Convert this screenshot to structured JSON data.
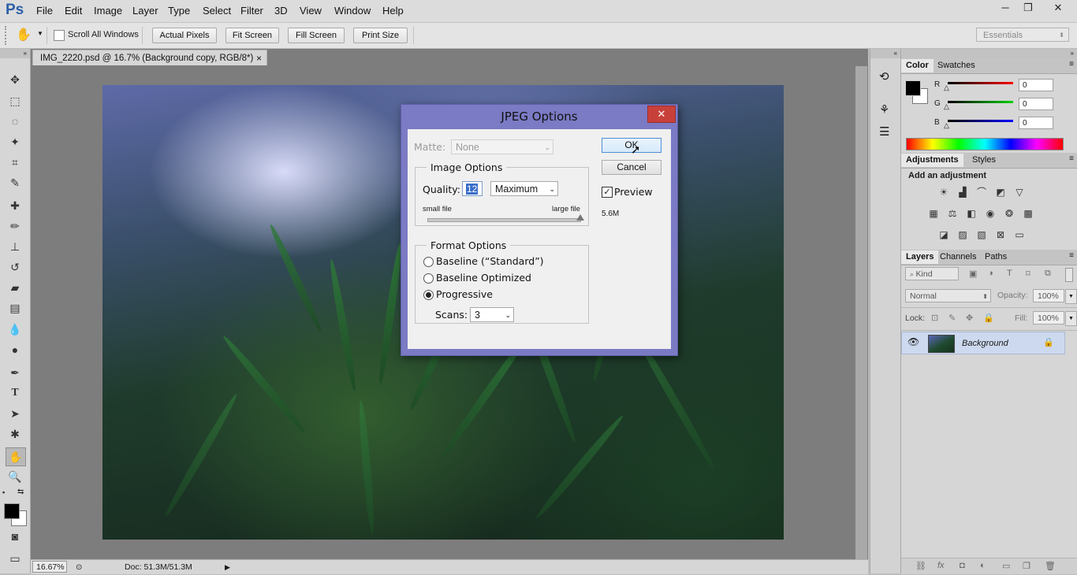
{
  "app": {
    "logo": "Ps"
  },
  "menu": [
    "File",
    "Edit",
    "Image",
    "Layer",
    "Type",
    "Select",
    "Filter",
    "3D",
    "View",
    "Window",
    "Help"
  ],
  "window_controls": {
    "minimize": "─",
    "restore": "❐",
    "close": "✕"
  },
  "options_bar": {
    "scroll_all_label": "Scroll All Windows",
    "buttons": [
      "Actual Pixels",
      "Fit Screen",
      "Fill Screen",
      "Print Size"
    ],
    "workspace": "Essentials"
  },
  "document": {
    "tab_title": "IMG_2220.psd @ 16.7% (Background copy, RGB/8*)",
    "tab_close": "×",
    "zoom": "16.67%",
    "doc_info": "Doc: 51.3M/51.3M"
  },
  "dialog": {
    "title": "JPEG Options",
    "close": "✕",
    "matte_label": "Matte:",
    "matte_value": "None",
    "image_options_legend": "Image Options",
    "quality_label": "Quality:",
    "quality_value": "12",
    "quality_preset": "Maximum",
    "small_file": "small file",
    "large_file": "large file",
    "quality_fraction": 1.0,
    "format_options_legend": "Format Options",
    "formats": [
      "Baseline (“Standard”)",
      "Baseline Optimized",
      "Progressive"
    ],
    "selected_format": "Progressive",
    "scans_label": "Scans:",
    "scans_value": "3",
    "ok_label": "OK",
    "cancel_label": "Cancel",
    "preview_label": "Preview",
    "preview_checked": true,
    "file_size": "5.6M"
  },
  "color_panel": {
    "tabs": [
      "Color",
      "Swatches"
    ],
    "channels": [
      {
        "label": "R",
        "value": "0",
        "color": "#e02020"
      },
      {
        "label": "G",
        "value": "0",
        "color": "#20b020"
      },
      {
        "label": "B",
        "value": "0",
        "color": "#2020d0"
      }
    ]
  },
  "adjustments_panel": {
    "tabs": [
      "Adjustments",
      "Styles"
    ],
    "heading": "Add an adjustment"
  },
  "layers_panel": {
    "tabs": [
      "Layers",
      "Channels",
      "Paths"
    ],
    "kind_label": "Kind",
    "blend_mode": "Normal",
    "opacity_label": "Opacity:",
    "opacity_value": "100%",
    "lock_label": "Lock:",
    "fill_label": "Fill:",
    "fill_value": "100%",
    "layer_name": "Background"
  }
}
